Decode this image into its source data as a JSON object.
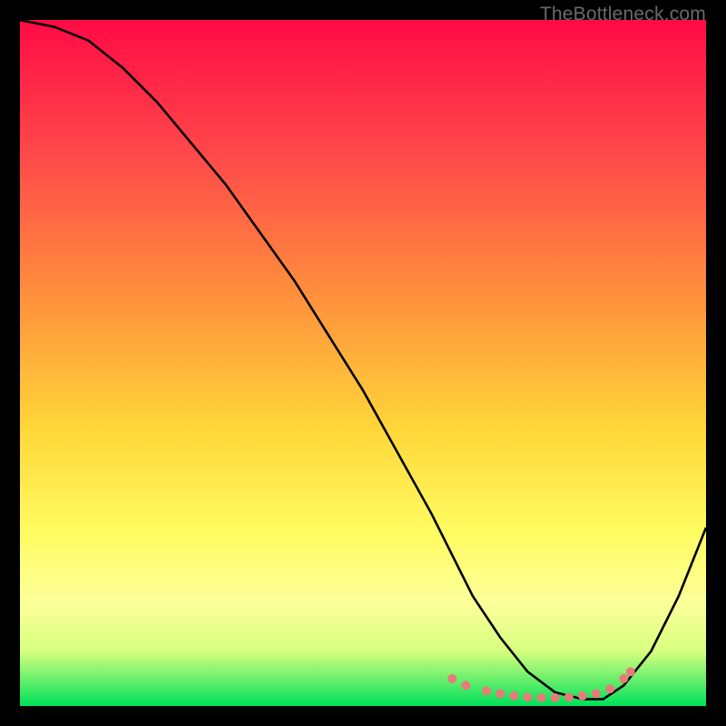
{
  "watermark": "TheBottleneck.com",
  "chart_data": {
    "type": "line",
    "title": "",
    "xlabel": "",
    "ylabel": "",
    "xlim": [
      0,
      100
    ],
    "ylim": [
      0,
      100
    ],
    "grid": false,
    "legend": false,
    "series": [
      {
        "name": "curve-black",
        "color": "#000000",
        "x": [
          0,
          5,
          10,
          15,
          20,
          25,
          30,
          35,
          40,
          45,
          50,
          55,
          60,
          63,
          66,
          70,
          74,
          78,
          82,
          85,
          88,
          92,
          96,
          100
        ],
        "y": [
          100,
          99,
          97,
          93,
          88,
          82,
          76,
          69,
          62,
          54,
          46,
          37,
          28,
          22,
          16,
          10,
          5,
          2,
          1,
          1,
          3,
          8,
          16,
          26
        ]
      }
    ],
    "markers": [
      {
        "name": "valley-dots",
        "color": "#e97a7a",
        "points": [
          {
            "x": 63,
            "y": 4
          },
          {
            "x": 65,
            "y": 3
          },
          {
            "x": 68,
            "y": 2.2
          },
          {
            "x": 70,
            "y": 1.8
          },
          {
            "x": 72,
            "y": 1.5
          },
          {
            "x": 74,
            "y": 1.3
          },
          {
            "x": 76,
            "y": 1.2
          },
          {
            "x": 78,
            "y": 1.2
          },
          {
            "x": 80,
            "y": 1.3
          },
          {
            "x": 82,
            "y": 1.5
          },
          {
            "x": 84,
            "y": 1.8
          },
          {
            "x": 86,
            "y": 2.5
          },
          {
            "x": 88,
            "y": 4.0
          },
          {
            "x": 89,
            "y": 5.0
          }
        ]
      }
    ]
  }
}
